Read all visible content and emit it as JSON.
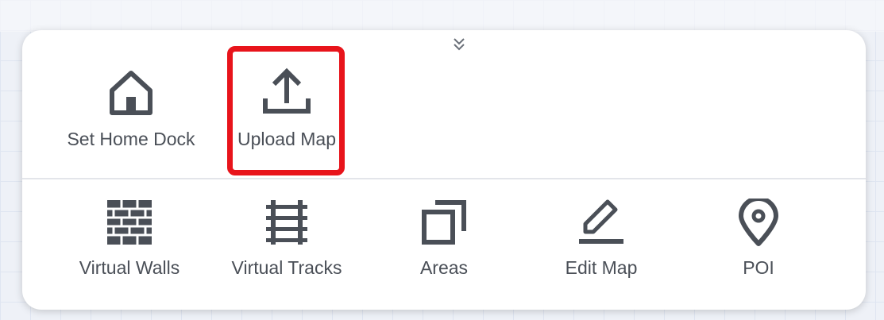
{
  "panel": {
    "collapse_icon": "double-chevron-down-icon",
    "row1": [
      {
        "id": "set-home-dock",
        "label": "Set Home Dock",
        "icon": "home-icon"
      },
      {
        "id": "upload-map",
        "label": "Upload Map",
        "icon": "upload-icon"
      }
    ],
    "row2": [
      {
        "id": "virtual-walls",
        "label": "Virtual Walls",
        "icon": "wall-icon"
      },
      {
        "id": "virtual-tracks",
        "label": "Virtual Tracks",
        "icon": "tracks-icon"
      },
      {
        "id": "areas",
        "label": "Areas",
        "icon": "areas-icon"
      },
      {
        "id": "edit-map",
        "label": "Edit Map",
        "icon": "pencil-icon"
      },
      {
        "id": "poi",
        "label": "POI",
        "icon": "location-pin-icon"
      }
    ]
  },
  "colors": {
    "highlight": "#e8141b",
    "icon": "#4a4f57"
  }
}
